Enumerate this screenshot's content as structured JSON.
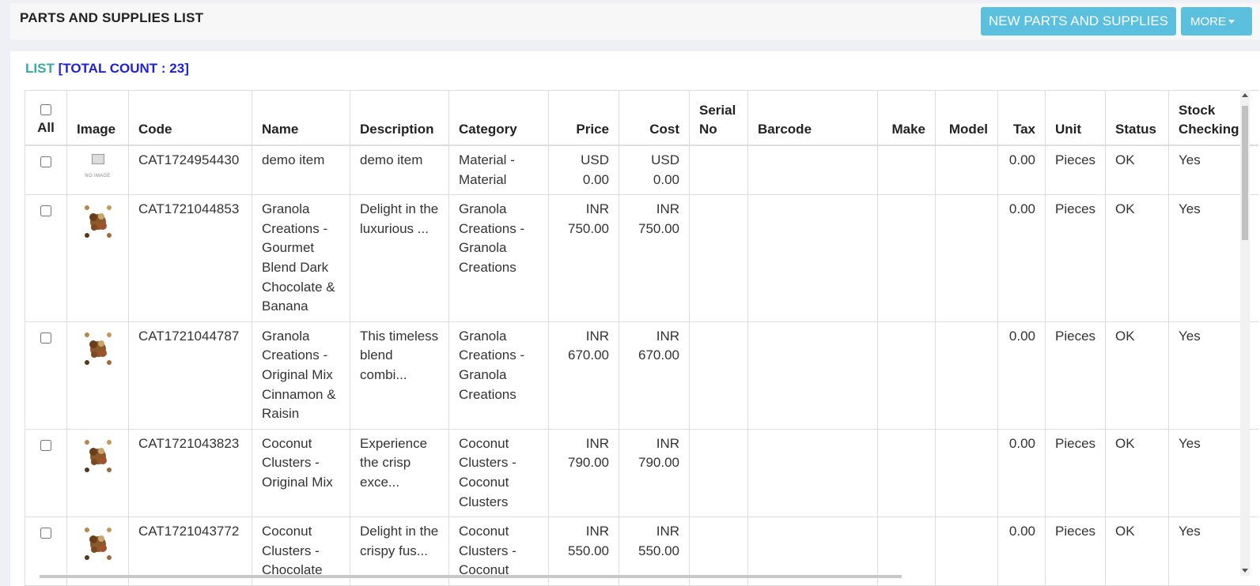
{
  "header": {
    "title": "PARTS AND SUPPLIES LIST",
    "new_button": "NEW PARTS AND SUPPLIES",
    "more_button": "MORE"
  },
  "list": {
    "label": "LIST",
    "count_text": "[TOTAL COUNT : 23]"
  },
  "table": {
    "headers": {
      "all": "All",
      "image": "Image",
      "code": "Code",
      "name": "Name",
      "description": "Description",
      "category": "Category",
      "price": "Price",
      "cost": "Cost",
      "serial_no": "Serial No",
      "barcode": "Barcode",
      "make": "Make",
      "model": "Model",
      "tax": "Tax",
      "unit": "Unit",
      "status": "Status",
      "stock_checking": "Stock Checking"
    },
    "no_image_text": "NO IMAGE",
    "rows": [
      {
        "code": "CAT1724954430",
        "name": "demo item",
        "description": "demo item",
        "category": "Material - Material",
        "price": "USD 0.00",
        "cost": "USD 0.00",
        "serial_no": "",
        "barcode": "",
        "make": "",
        "model": "",
        "tax": "0.00",
        "unit": "Pieces",
        "status": "OK",
        "stock_checking": "Yes",
        "image": "no-image"
      },
      {
        "code": "CAT1721044853",
        "name": "Granola Creations - Gourmet Blend Dark Chocolate & Banana",
        "description": "Delight in the luxurious ...",
        "category": "Granola Creations - Granola Creations",
        "price": "INR 750.00",
        "cost": "INR 750.00",
        "serial_no": "",
        "barcode": "",
        "make": "",
        "model": "",
        "tax": "0.00",
        "unit": "Pieces",
        "status": "OK",
        "stock_checking": "Yes",
        "image": "product-photo"
      },
      {
        "code": "CAT1721044787",
        "name": "Granola Creations - Original Mix Cinnamon & Raisin",
        "description": "This timeless blend combi...",
        "category": "Granola Creations - Granola Creations",
        "price": "INR 670.00",
        "cost": "INR 670.00",
        "serial_no": "",
        "barcode": "",
        "make": "",
        "model": "",
        "tax": "0.00",
        "unit": "Pieces",
        "status": "OK",
        "stock_checking": "Yes",
        "image": "product-photo"
      },
      {
        "code": "CAT1721043823",
        "name": "Coconut Clusters - Original Mix",
        "description": "Experience the crisp exce...",
        "category": "Coconut Clusters - Coconut Clusters",
        "price": "INR 790.00",
        "cost": "INR 790.00",
        "serial_no": "",
        "barcode": "",
        "make": "",
        "model": "",
        "tax": "0.00",
        "unit": "Pieces",
        "status": "OK",
        "stock_checking": "Yes",
        "image": "product-photo"
      },
      {
        "code": "CAT1721043772",
        "name": "Coconut Clusters - Chocolate",
        "description": "Delight in the crispy fus...",
        "category": "Coconut Clusters - Coconut",
        "price": "INR 550.00",
        "cost": "INR 550.00",
        "serial_no": "",
        "barcode": "",
        "make": "",
        "model": "",
        "tax": "0.00",
        "unit": "Pieces",
        "status": "OK",
        "stock_checking": "Yes",
        "image": "product-photo"
      }
    ]
  },
  "colors": {
    "accent_button": "#5bc0de",
    "list_label": "#3aa99f",
    "count_text": "#1f1fe0"
  }
}
